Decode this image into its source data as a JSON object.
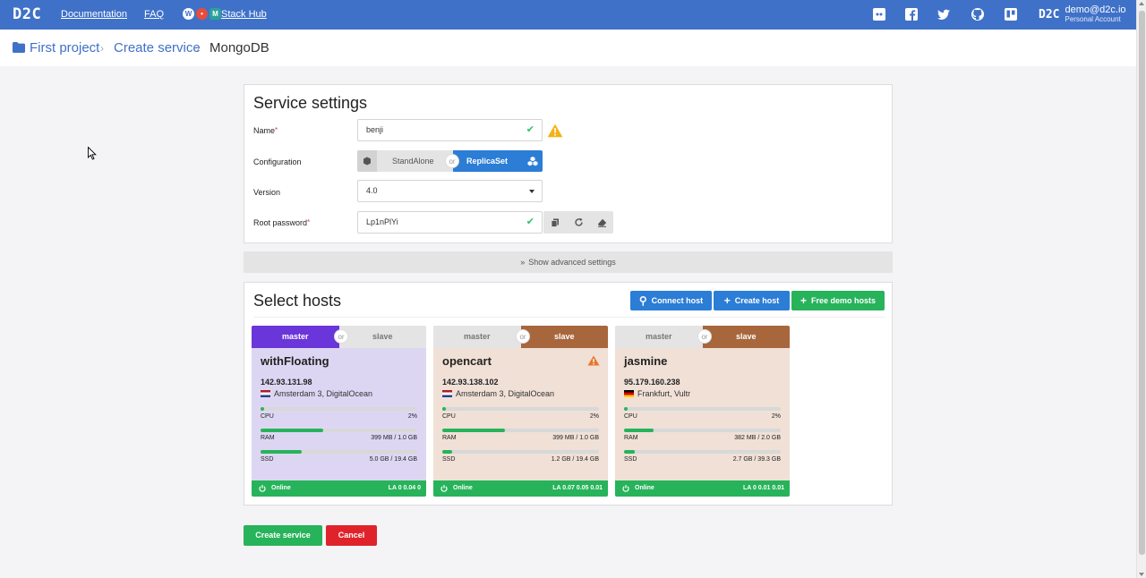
{
  "topbar": {
    "logo": "D2C",
    "links": [
      "Documentation",
      "FAQ"
    ],
    "stack_hub_label": "Stack Hub",
    "social_icons": [
      "discord-icon",
      "facebook-icon",
      "twitter-icon",
      "github-icon",
      "trello-icon"
    ],
    "account": {
      "logo": "D2C",
      "email": "demo@d2c.io",
      "type": "Personal Account"
    }
  },
  "breadcrumb": [
    "First project",
    "Create service",
    "MongoDB"
  ],
  "service_settings": {
    "title": "Service settings",
    "name_label": "Name",
    "name_value": "benji",
    "config_label": "Configuration",
    "config_options": [
      "StandAlone",
      "ReplicaSet"
    ],
    "config_selected": "ReplicaSet",
    "or_label": "or",
    "version_label": "Version",
    "version_value": "4.0",
    "password_label": "Root password",
    "password_value": "Lp1nPlYi"
  },
  "advanced_label": "Show advanced settings",
  "select_hosts": {
    "title": "Select hosts",
    "buttons": [
      "Connect host",
      "Create host",
      "Free demo hosts"
    ]
  },
  "hosts": [
    {
      "master": "master",
      "slave": "slave",
      "or": "or",
      "selected": "master",
      "name": "withFloating",
      "ip": "142.93.131.98",
      "location": "Amsterdam 3, DigitalOcean",
      "flag": "nl",
      "warning": false,
      "cpu_label": "CPU",
      "cpu_value": "2%",
      "cpu_pct": 2,
      "ram_label": "RAM",
      "ram_value": "399 MB / 1.0 GB",
      "ram_pct": 40,
      "ssd_label": "SSD",
      "ssd_value": "5.0 GB / 19.4 GB",
      "ssd_pct": 26,
      "status": "Online",
      "la": "LA 0 0.04 0"
    },
    {
      "master": "master",
      "slave": "slave",
      "or": "or",
      "selected": "slave",
      "name": "opencart",
      "ip": "142.93.138.102",
      "location": "Amsterdam 3, DigitalOcean",
      "flag": "nl",
      "warning": true,
      "cpu_label": "CPU",
      "cpu_value": "2%",
      "cpu_pct": 2,
      "ram_label": "RAM",
      "ram_value": "399 MB / 1.0 GB",
      "ram_pct": 40,
      "ssd_label": "SSD",
      "ssd_value": "1.2 GB / 19.4 GB",
      "ssd_pct": 6,
      "status": "Online",
      "la": "LA 0.07 0.05 0.01"
    },
    {
      "master": "master",
      "slave": "slave",
      "or": "or",
      "selected": "slave",
      "name": "jasmine",
      "ip": "95.179.160.238",
      "location": "Frankfurt, Vultr",
      "flag": "de",
      "warning": false,
      "cpu_label": "CPU",
      "cpu_value": "2%",
      "cpu_pct": 2,
      "ram_label": "RAM",
      "ram_value": "382 MB / 2.0 GB",
      "ram_pct": 19,
      "ssd_label": "SSD",
      "ssd_value": "2.7 GB / 39.3 GB",
      "ssd_pct": 7,
      "status": "Online",
      "la": "LA 0 0.01 0.01"
    }
  ],
  "footer_buttons": {
    "create": "Create service",
    "cancel": "Cancel"
  },
  "colors": {
    "topbar": "#3f71c8",
    "blue": "#2b7dd6",
    "green": "#27b35a",
    "red": "#e0232b",
    "master_active": "#6a35d9",
    "master_card_bg": "#ddd6f3",
    "slave_active": "#a8663c",
    "slave_card_bg": "#f0e0d6",
    "inactive_tab": "#e4e4e4"
  }
}
